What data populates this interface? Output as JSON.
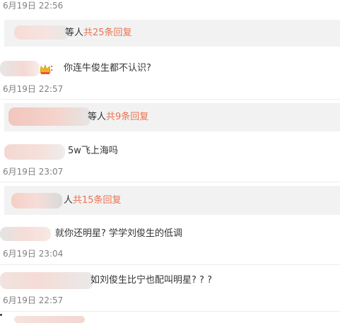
{
  "comments": [
    {
      "time": "6月19日 22:56"
    },
    {
      "reply_suffix": "等人",
      "reply_count": "共25条回复"
    },
    {
      "text": "你连牛俊生都不认识?",
      "time": "6月19日 22:57"
    },
    {
      "reply_suffix": "等人",
      "reply_count": "共9条回复"
    },
    {
      "text": "5w飞上海吗",
      "time": "6月19日 23:07"
    },
    {
      "reply_suffix": "人",
      "reply_count": "共15条回复"
    },
    {
      "text": "就你还明星? 学学刘俊生的低调",
      "time": "6月19日 23:04"
    },
    {
      "text": "​如刘俊生比宁也配叫明星? ? ?",
      "time": "6月19日 22:57"
    }
  ],
  "colors": {
    "accent": "#eb7350",
    "reply_bg": "#f2f2f2",
    "time": "#808080"
  }
}
